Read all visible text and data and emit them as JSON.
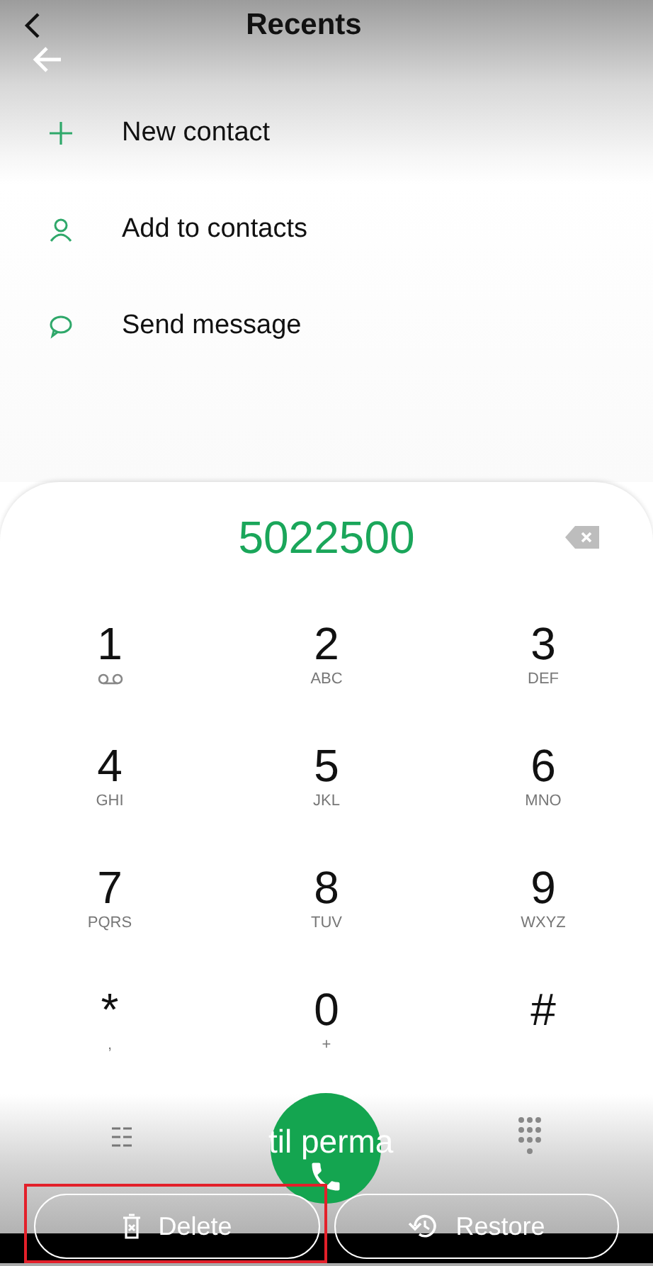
{
  "header": {
    "title": "Recents"
  },
  "actions": [
    {
      "kind": "add",
      "label": "New contact"
    },
    {
      "kind": "person",
      "label": "Add to contacts"
    },
    {
      "kind": "message",
      "label": "Send message"
    }
  ],
  "dialer": {
    "number": "5022500"
  },
  "keys": [
    {
      "digit": "1",
      "kind": "voicemail"
    },
    {
      "digit": "2",
      "letters": "ABC"
    },
    {
      "digit": "3",
      "letters": "DEF"
    },
    {
      "digit": "4",
      "letters": "GHI"
    },
    {
      "digit": "5",
      "letters": "JKL"
    },
    {
      "digit": "6",
      "letters": "MNO"
    },
    {
      "digit": "7",
      "letters": "PQRS"
    },
    {
      "digit": "8",
      "letters": "TUV"
    },
    {
      "digit": "9",
      "letters": "WXYZ"
    },
    {
      "digit": "*",
      "letters": ","
    },
    {
      "digit": "0",
      "letters": "+"
    },
    {
      "digit": "#"
    }
  ],
  "overlay_text": "til perma",
  "buttons": [
    {
      "kind": "delete",
      "label": "Delete",
      "highlighted": true
    },
    {
      "kind": "restore",
      "label": "Restore",
      "highlighted": false
    }
  ]
}
